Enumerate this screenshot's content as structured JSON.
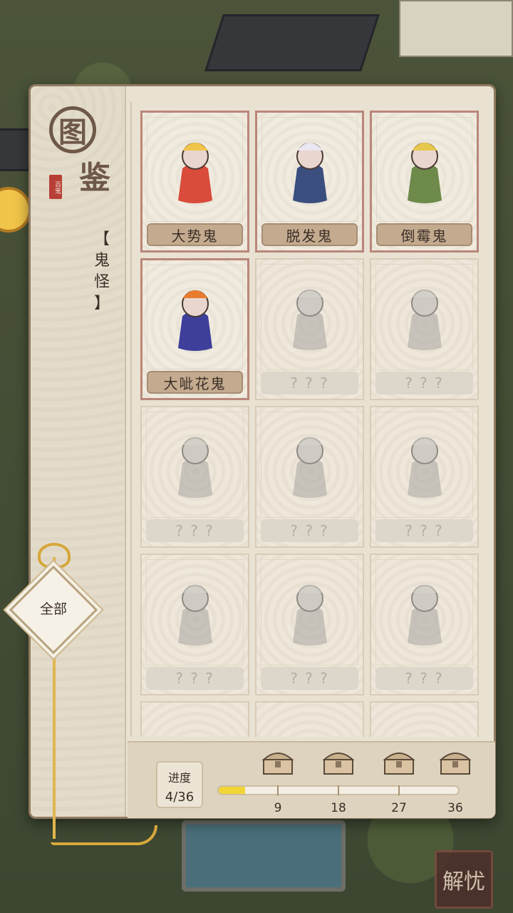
{
  "panel": {
    "title_char_1": "图",
    "title_char_2": "鉴",
    "seal_text": "百鬼",
    "category_label": "【鬼怪】",
    "category_chars": [
      "【",
      "鬼",
      "怪",
      "】"
    ],
    "filter_label": "全部"
  },
  "cards": [
    {
      "name": "大势鬼",
      "unlocked": true,
      "icon": "ghost-monk-icon"
    },
    {
      "name": "脱发鬼",
      "unlocked": true,
      "icon": "ghost-scholar-icon"
    },
    {
      "name": "倒霉鬼",
      "unlocked": true,
      "icon": "ghost-unlucky-icon"
    },
    {
      "name": "大呲花鬼",
      "unlocked": true,
      "icon": "ghost-firework-icon"
    },
    {
      "name": "? ? ?",
      "unlocked": false,
      "icon": "ghost-silhouette-icon"
    },
    {
      "name": "? ? ?",
      "unlocked": false,
      "icon": "ghost-silhouette-icon"
    },
    {
      "name": "? ? ?",
      "unlocked": false,
      "icon": "ghost-silhouette-icon"
    },
    {
      "name": "? ? ?",
      "unlocked": false,
      "icon": "ghost-silhouette-icon"
    },
    {
      "name": "? ? ?",
      "unlocked": false,
      "icon": "ghost-silhouette-icon"
    },
    {
      "name": "? ? ?",
      "unlocked": false,
      "icon": "ghost-silhouette-icon"
    },
    {
      "name": "? ? ?",
      "unlocked": false,
      "icon": "ghost-silhouette-icon"
    },
    {
      "name": "? ? ?",
      "unlocked": false,
      "icon": "ghost-silhouette-icon"
    }
  ],
  "progress": {
    "label": "进度",
    "value_text": "4/36",
    "current": 4,
    "total": 36,
    "milestones": [
      "9",
      "18",
      "27",
      "36"
    ],
    "reward_icon": "treasure-chest-icon"
  },
  "corner_button": "解忧",
  "colors": {
    "accent_gold": "#f1d636",
    "card_border_unlocked": "#b9877a",
    "name_plate": "#c4ab8f"
  }
}
